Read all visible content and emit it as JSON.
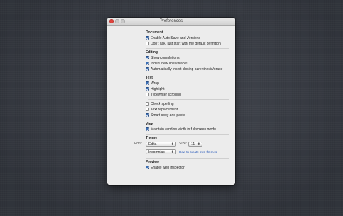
{
  "window": {
    "title": "Preferences"
  },
  "sections": {
    "document": {
      "title": "Document",
      "items": [
        {
          "label": "Enable Auto Save and Versions",
          "checked": true
        },
        {
          "label": "Don't ask, just start with the default definition",
          "checked": false
        }
      ]
    },
    "editing": {
      "title": "Editing",
      "items": [
        {
          "label": "Show completions",
          "checked": true
        },
        {
          "label": "Indent new lines/braces",
          "checked": true
        },
        {
          "label": "Automatically insert closing parenthesis/brace",
          "checked": true
        }
      ]
    },
    "text": {
      "title": "Text",
      "items": [
        {
          "label": "Wrap",
          "checked": true
        },
        {
          "label": "Highlight",
          "checked": true
        },
        {
          "label": "Typewriter scrolling",
          "checked": false
        },
        {
          "label": "Check spelling",
          "checked": false
        },
        {
          "label": "Text replacement",
          "checked": false
        },
        {
          "label": "Smart copy and paste",
          "checked": true
        }
      ]
    },
    "view": {
      "title": "View",
      "items": [
        {
          "label": "Maintain window width in fullscreen mode",
          "checked": true
        }
      ]
    },
    "theme": {
      "title": "Theme",
      "font_label": "Font:",
      "font_value": "Edita",
      "size_label": "Size:",
      "size_value": "11",
      "theme_value": "Insomniac",
      "create_link": "How to create own themes"
    },
    "preview": {
      "title": "Preview",
      "items": [
        {
          "label": "Enable web inspector",
          "checked": true
        }
      ]
    }
  },
  "colors": {
    "desktop": "#3b3f48",
    "window_bg": "#ececec",
    "check_blue": "#3b6fb5",
    "link": "#1a4fb5"
  }
}
